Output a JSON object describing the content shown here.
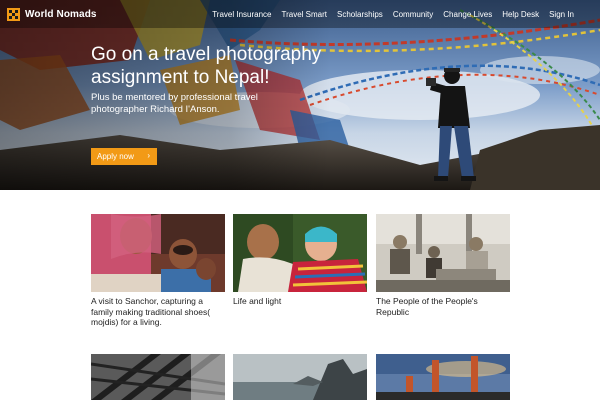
{
  "brand": {
    "name": "World Nomads",
    "logo_icon": "world-nomads-logo-icon",
    "accent": "#f29a16"
  },
  "nav": {
    "items": [
      {
        "label": "Travel Insurance"
      },
      {
        "label": "Travel Smart"
      },
      {
        "label": "Scholarships"
      },
      {
        "label": "Community"
      },
      {
        "label": "Change Lives"
      },
      {
        "label": "Help Desk"
      },
      {
        "label": "Sign In"
      }
    ]
  },
  "hero": {
    "title": "Go on a travel photography assignment to Nepal!",
    "subtitle": "Plus be mentored by professional travel photographer Richard I'Anson.",
    "cta_label": "Apply now",
    "cta_icon": "chevron-right-icon"
  },
  "cards": [
    {
      "caption": "A visit to Sanchor, capturing a family making traditional shoes( mojdis) for a living."
    },
    {
      "caption": "Life and light"
    },
    {
      "caption": "The People of the People's Republic"
    },
    {
      "caption": ""
    },
    {
      "caption": ""
    },
    {
      "caption": ""
    }
  ]
}
